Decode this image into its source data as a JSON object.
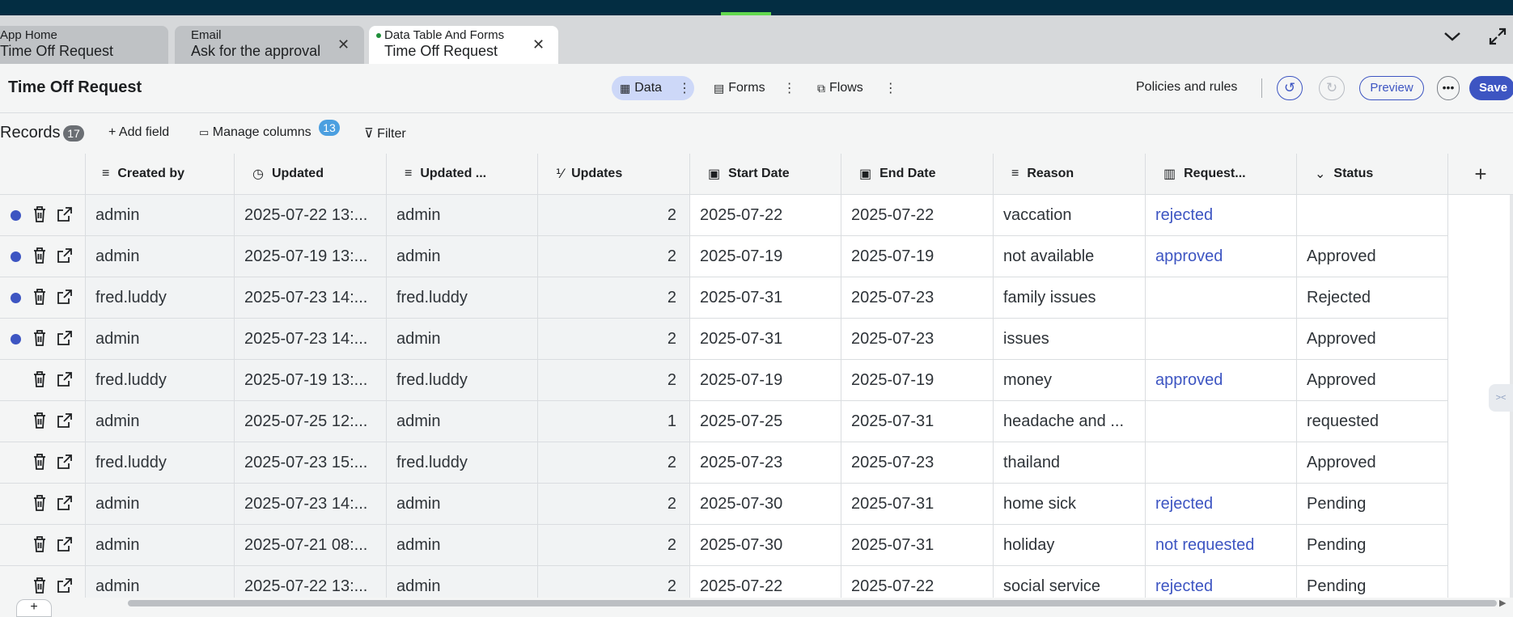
{
  "tabs": [
    {
      "top": "App Home",
      "bottom": "Time Off Request",
      "closable": false
    },
    {
      "top": "Email",
      "bottom": "Ask for the approval",
      "closable": true
    },
    {
      "top": "Data Table And Forms",
      "bottom": "Time Off Request",
      "closable": true,
      "active": true
    }
  ],
  "header": {
    "title": "Time Off Request",
    "segments": {
      "data": "Data",
      "forms": "Forms",
      "flows": "Flows"
    },
    "policies": "Policies and rules",
    "preview": "Preview",
    "save": "Save"
  },
  "records": {
    "label": "Records",
    "count": "17",
    "add_field": "Add field",
    "manage_columns": "Manage columns",
    "manage_count": "13",
    "filter": "Filter"
  },
  "columns": [
    "Created by",
    "Updated",
    "Updated ...",
    "Updates",
    "Start Date",
    "End Date",
    "Reason",
    "Request...",
    "Status"
  ],
  "rows": [
    {
      "dot": true,
      "c": [
        "admin",
        "2025-07-22 13:...",
        "admin",
        "2",
        "2025-07-22",
        "2025-07-22",
        "vaccation",
        "rejected",
        ""
      ]
    },
    {
      "dot": true,
      "c": [
        "admin",
        "2025-07-19 13:...",
        "admin",
        "2",
        "2025-07-19",
        "2025-07-19",
        "not available",
        "approved",
        "Approved"
      ]
    },
    {
      "dot": true,
      "c": [
        "fred.luddy",
        "2025-07-23 14:...",
        "fred.luddy",
        "2",
        "2025-07-31",
        "2025-07-23",
        "family issues",
        "",
        "Rejected"
      ]
    },
    {
      "dot": true,
      "c": [
        "admin",
        "2025-07-23 14:...",
        "admin",
        "2",
        "2025-07-31",
        "2025-07-23",
        "issues",
        "",
        "Approved"
      ]
    },
    {
      "dot": false,
      "c": [
        "fred.luddy",
        "2025-07-19 13:...",
        "fred.luddy",
        "2",
        "2025-07-19",
        "2025-07-19",
        "money",
        "approved",
        "Approved"
      ]
    },
    {
      "dot": false,
      "c": [
        "admin",
        "2025-07-25 12:...",
        "admin",
        "1",
        "2025-07-25",
        "2025-07-31",
        "headache and ...",
        "",
        "requested"
      ]
    },
    {
      "dot": false,
      "c": [
        "fred.luddy",
        "2025-07-23 15:...",
        "fred.luddy",
        "2",
        "2025-07-23",
        "2025-07-23",
        "thailand",
        "",
        "Approved"
      ]
    },
    {
      "dot": false,
      "c": [
        "admin",
        "2025-07-23 14:...",
        "admin",
        "2",
        "2025-07-30",
        "2025-07-31",
        "home sick",
        "rejected",
        "Pending"
      ]
    },
    {
      "dot": false,
      "c": [
        "admin",
        "2025-07-21 08:...",
        "admin",
        "2",
        "2025-07-30",
        "2025-07-31",
        "holiday",
        "not requested",
        "Pending"
      ]
    },
    {
      "dot": false,
      "c": [
        "admin",
        "2025-07-22 13:...",
        "admin",
        "2",
        "2025-07-22",
        "2025-07-22",
        "social service",
        "rejected",
        "Pending"
      ]
    }
  ],
  "colors": {
    "accent": "#3d55c2",
    "topbar": "#032d42",
    "active_indicator": "#62d84e",
    "badge_blue": "#4b9fe0"
  }
}
